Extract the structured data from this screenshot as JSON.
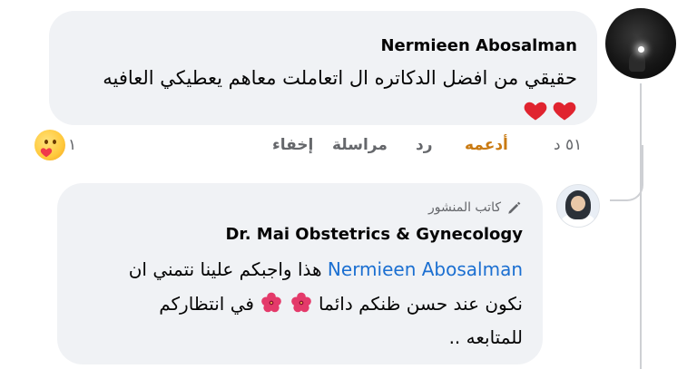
{
  "comment": {
    "author": "Nermieen Abosalman",
    "text": "حقيقي من افضل الدكاتره ال اتعاملت معاهم يعطيكي العافيه",
    "emojis": [
      "red-heart",
      "red-heart"
    ],
    "actions": {
      "time": "٥١ د",
      "like": "أدعمه",
      "reply": "رد",
      "message": "مراسلة",
      "hide": "إخفاء"
    },
    "reaction_count": "١",
    "reaction_type": "care"
  },
  "reply": {
    "badge": "كاتب المنشور",
    "author": "Dr. Mai Obstetrics & Gynecology",
    "mention": "Nermieen Abosalman",
    "line1_text": "هذا واجبكم علينا نتمني ان",
    "line2_text": "نكون عند حسن ظنكم دائما",
    "line2_suffix": "في انتظاركم",
    "line3_text": "للمتابعه ..",
    "emojis": [
      "hibiscus",
      "hibiscus"
    ]
  },
  "colors": {
    "bubble": "#f0f2f5",
    "like_active": "#c97a12",
    "mention": "#1b6fd1",
    "muted": "#65676b"
  }
}
